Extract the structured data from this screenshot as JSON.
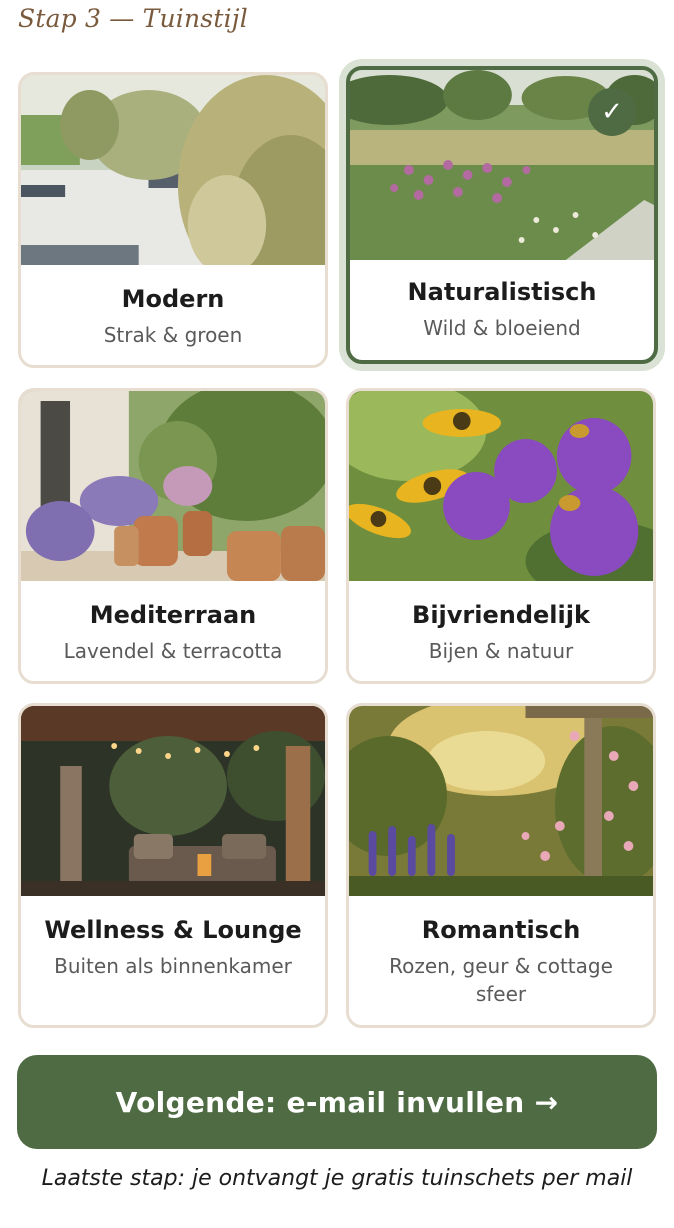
{
  "header": {
    "step_title": "Stap 3 — Tuinstijl"
  },
  "styles": [
    {
      "title": "Modern",
      "subtitle": "Strak & groen",
      "selected": false
    },
    {
      "title": "Naturalistisch",
      "subtitle": "Wild & bloeiend",
      "selected": true
    },
    {
      "title": "Mediterraan",
      "subtitle": "Lavendel & terracotta",
      "selected": false
    },
    {
      "title": "Bijvriendelijk",
      "subtitle": "Bijen & natuur",
      "selected": false
    },
    {
      "title": "Wellness & Lounge",
      "subtitle": "Buiten als binnenkamer",
      "selected": false
    },
    {
      "title": "Romantisch",
      "subtitle": "Rozen, geur & cottage sfeer",
      "selected": false
    }
  ],
  "selected_check": "✓",
  "actions": {
    "next_label": "Volgende: e-mail invullen →",
    "footnote": "Laatste stap: je ontvangt je gratis tuinschets per mail"
  },
  "colors": {
    "accent": "#4f6b43",
    "card_border": "#e7ddd0",
    "step_title": "#7a5a3d"
  }
}
